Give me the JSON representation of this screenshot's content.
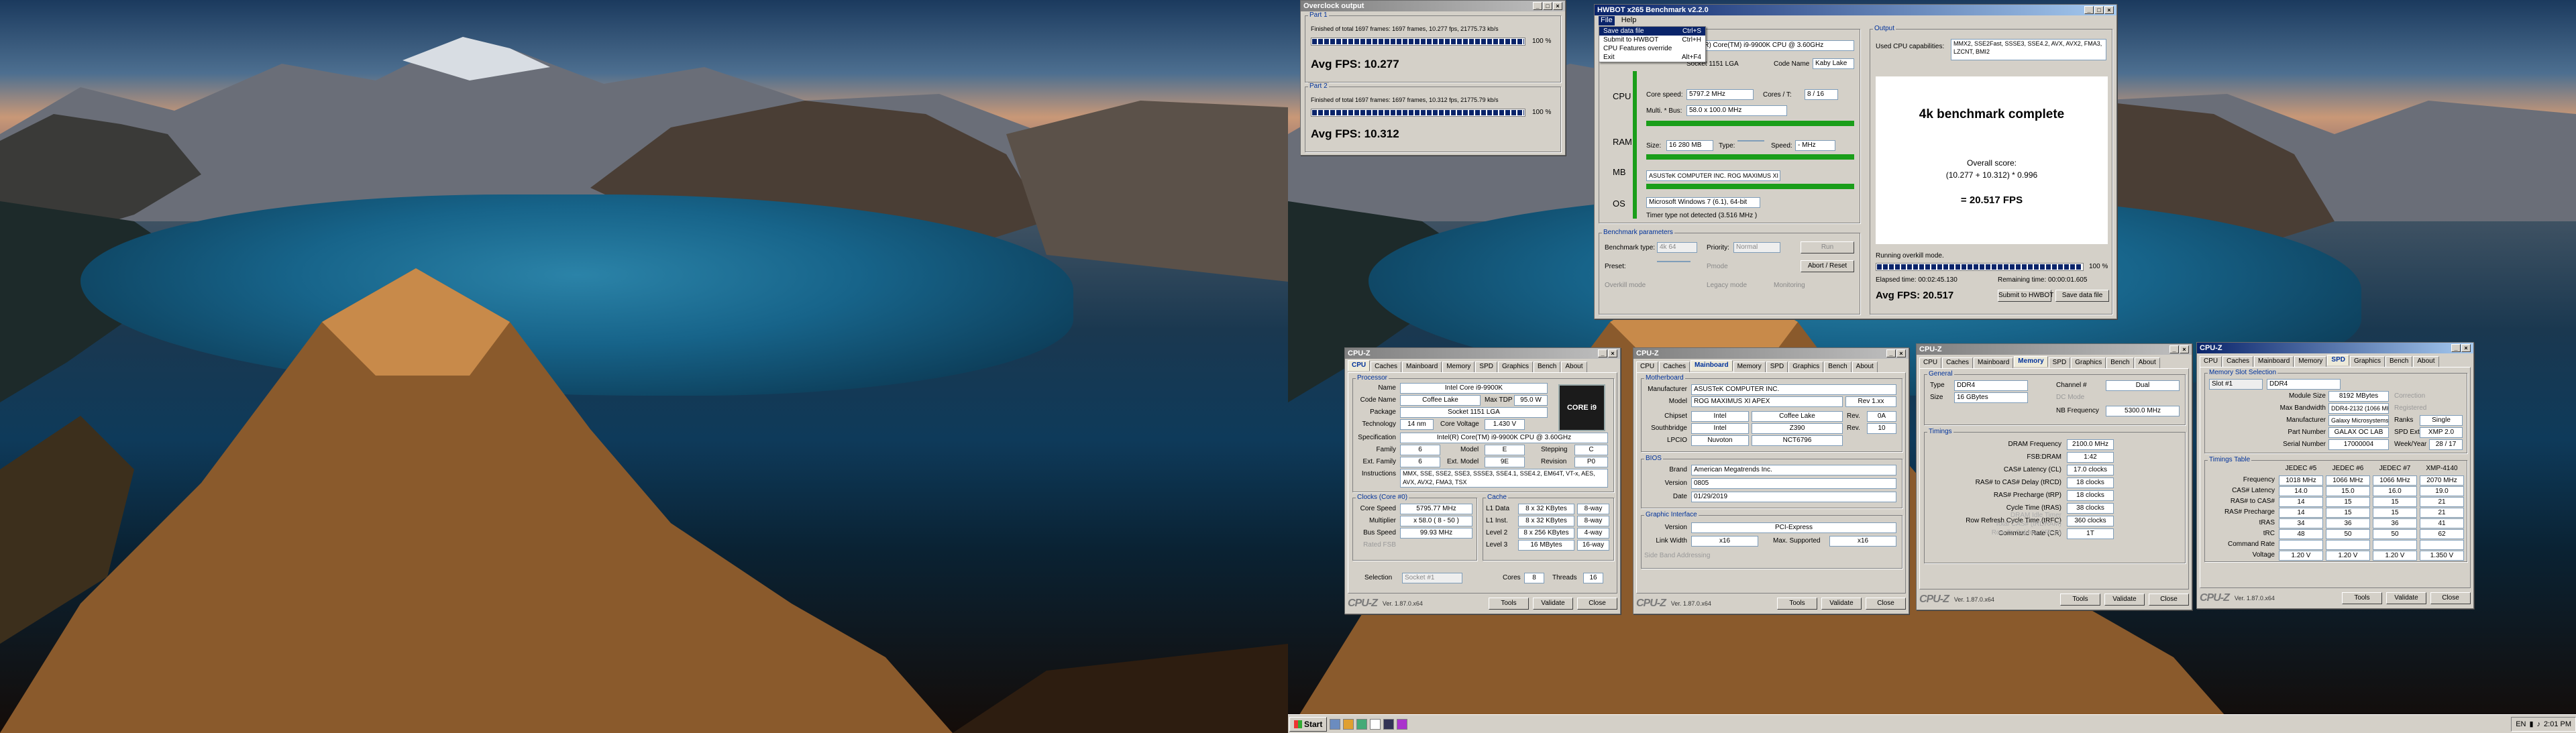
{
  "overclock_output": {
    "title": "Overclock output",
    "part1": {
      "label": "Part 1",
      "status": "Finished of total 1697 frames: 1697 frames, 10.277 fps, 21775.73 kb/s",
      "percent": "100 %",
      "progress": 1.0,
      "avg": "Avg FPS: 10.277"
    },
    "part2": {
      "label": "Part 2",
      "status": "Finished of total 1697 frames: 1697 frames, 10.312 fps, 21775.79 kb/s",
      "percent": "100 %",
      "progress": 1.0,
      "avg": "Avg FPS: 10.312"
    }
  },
  "hwbot": {
    "title": "HWBOT x265 Benchmark v2.2.0",
    "menubar": [
      "File",
      "Help"
    ],
    "file_menu": [
      {
        "label": "Save data file",
        "shortcut": "Ctrl+S"
      },
      {
        "label": "Submit to HWBOT",
        "shortcut": "Ctrl+H"
      },
      {
        "label": "CPU Features override",
        "shortcut": ""
      },
      {
        "label": "Exit",
        "shortcut": "Alt+F4"
      }
    ],
    "processor_field": "Intel(R) Core(TM) i9-9900K CPU @ 3.60GHz",
    "socket_text": "Socket 1151 LGA",
    "codename_label": "Code Name",
    "codename": "Kaby Lake",
    "side_labels": [
      "CPU",
      "RAM",
      "MB",
      "OS"
    ],
    "core_speed_label": "Core speed:",
    "core_speed": "5797.2 MHz",
    "cores_label": "Cores / T:",
    "cores": "8 / 16",
    "multi_label": "Multi. * Bus:",
    "multi": "58.0 x 100.0 MHz",
    "size_label": "Size:",
    "size": "16 280 MB",
    "type_label": "Type:",
    "type": "",
    "speed_label": "Speed:",
    "speed": "- MHz",
    "board": "ASUSTeK COMPUTER INC. ROG MAXIMUS XI APEX",
    "os": "Microsoft Windows 7 (6.1), 64-bit",
    "timer": "Timer type not detected (3.516 MHz )",
    "bench_params": "Benchmark parameters",
    "bench_type_label": "Benchmark type:",
    "bench_type": "4k 64",
    "priority_label": "Priority:",
    "priority": "Normal",
    "run_btn": "Run",
    "preset_label": "Preset:",
    "preset": "",
    "pmode_label": "Pmode",
    "abort_btn": "Abort / Reset",
    "overkill_label": "Overkill mode",
    "legacy_label": "Legacy mode",
    "monitoring_label": "Monitoring",
    "output_label": "Output",
    "used_caps_label": "Used CPU capabilities:",
    "used_caps": "MMX2, SSE2Fast, SSSE3, SSE4.2, AVX, AVX2, FMA3, LZCNT, BMI2",
    "complete": "4k benchmark complete",
    "overall_label": "Overall score:",
    "formula": "(10.277 + 10.312) * 0.996",
    "score": "= 20.517 FPS",
    "running_label": "Running overkill mode.",
    "run_percent": "100 %",
    "run_progress": 1.0,
    "elapsed": "Elapsed time: 00:02:45.130",
    "remaining": "Remaining time: 00:00:01.605",
    "avg": "Avg FPS: 20.517",
    "submit_btn": "Submit to HWBOT",
    "save_btn": "Save data file"
  },
  "cpuz_tabs": [
    "CPU",
    "Caches",
    "Mainboard",
    "Memory",
    "SPD",
    "Graphics",
    "Bench",
    "About"
  ],
  "cpuz_common": {
    "title": "CPU-Z",
    "logo": "CPU-Z",
    "version": "Ver. 1.87.0.x64",
    "tools_btn": "Tools",
    "validate_btn": "Validate",
    "close_btn": "Close"
  },
  "cpuz1": {
    "processor_group": "Processor",
    "rows": [
      {
        "label": "Name",
        "value": "Intel Core i9-9900K"
      },
      {
        "label": "Code Name",
        "value": "Coffee Lake"
      },
      {
        "label": "Package",
        "value": "Socket 1151 LGA"
      },
      {
        "label": "Technology",
        "value": "14 nm"
      }
    ],
    "maxtdp_label": "Max TDP",
    "maxtdp": "95.0 W",
    "corevolt_label": "Core Voltage",
    "corevolt": "1.430 V",
    "badge": "CORE i9",
    "spec_label": "Specification",
    "spec": "Intel(R) Core(TM) i9-9900K CPU @ 3.60GHz",
    "family_label": "Family",
    "family": "6",
    "model_label": "Model",
    "model": "E",
    "stepping_label": "Stepping",
    "stepping": "C",
    "extfam_label": "Ext. Family",
    "extfam": "6",
    "extmodel_label": "Ext. Model",
    "extmodel": "9E",
    "revision_label": "Revision",
    "revision": "P0",
    "instr_label": "Instructions",
    "instr": "MMX, SSE, SSE2, SSE3, SSSE3, SSE4.1, SSE4.2, EM64T, VT-x, AES, AVX, AVX2, FMA3, TSX",
    "clocks_group": "Clocks (Core #0)",
    "corespeed_label": "Core Speed",
    "corespeed": "5795.77 MHz",
    "multiplier_label": "Multiplier",
    "multiplier": "x 58.0 ( 8 - 50 )",
    "busspeed_label": "Bus Speed",
    "busspeed": "99.93 MHz",
    "ratedfsb_label": "Rated FSB",
    "cache_group": "Cache",
    "cache_rows": [
      {
        "label": "L1 Data",
        "value": "8 x 32 KBytes",
        "way": "8-way"
      },
      {
        "label": "L1 Inst.",
        "value": "8 x 32 KBytes",
        "way": "8-way"
      },
      {
        "label": "Level 2",
        "value": "8 x 256 KBytes",
        "way": "4-way"
      },
      {
        "label": "Level 3",
        "value": "16 MBytes",
        "way": "16-way"
      }
    ],
    "selection_label": "Selection",
    "selection": "Socket #1",
    "cores_label": "Cores",
    "cores": "8",
    "threads_label": "Threads",
    "threads": "16"
  },
  "cpuz2": {
    "mb_group": "Motherboard",
    "manufacturer_label": "Manufacturer",
    "manufacturer": "ASUSTeK COMPUTER INC.",
    "model_label": "Model",
    "model": "ROG MAXIMUS XI APEX",
    "rev": "Rev 1.xx",
    "chipset_label": "Chipset",
    "chipset_a": "Intel",
    "chipset_b": "Coffee Lake",
    "chipset_rev_label": "Rev.",
    "chipset_rev": "0A",
    "south_label": "Southbridge",
    "south_a": "Intel",
    "south_b": "Z390",
    "south_rev_label": "Rev.",
    "south_rev": "10",
    "lpcio_label": "LPCIO",
    "lpcio_a": "Nuvoton",
    "lpcio_b": "NCT6796",
    "bios_group": "BIOS",
    "brand_label": "Brand",
    "brand": "American Megatrends Inc.",
    "version_label": "Version",
    "version": "0805",
    "date_label": "Date",
    "date": "01/29/2019",
    "gfx_group": "Graphic Interface",
    "gversion_label": "Version",
    "gversion": "PCI-Express",
    "linkwidth_label": "Link Width",
    "linkwidth": "x16",
    "maxsup_label": "Max. Supported",
    "maxsup": "x16",
    "sideband_label": "Side Band Addressing"
  },
  "cpuz3": {
    "general_group": "General",
    "type_label": "Type",
    "type": "DDR4",
    "channel_label": "Channel #",
    "channel": "Dual",
    "size_label": "Size",
    "size": "16 GBytes",
    "dcmode_label": "DC Mode",
    "nb_label": "NB Frequency",
    "nb": "5300.0 MHz",
    "timings_group": "Timings",
    "rows": [
      {
        "label": "DRAM Frequency",
        "value": "2100.0 MHz"
      },
      {
        "label": "FSB:DRAM",
        "value": "1:42"
      },
      {
        "label": "CAS# Latency (CL)",
        "value": "17.0 clocks"
      },
      {
        "label": "RAS# to CAS# Delay (tRCD)",
        "value": "18 clocks"
      },
      {
        "label": "RAS# Precharge (tRP)",
        "value": "18 clocks"
      },
      {
        "label": "Cycle Time (tRAS)",
        "value": "38 clocks"
      },
      {
        "label": "Row Refresh Cycle Time (tRFC)",
        "value": "360 clocks"
      },
      {
        "label": "Command Rate (CR)",
        "value": "1T"
      }
    ],
    "dim_rows": [
      "DRAM Idle Timer",
      "Total CAS# (tRDRAM)",
      "Row To Column (tRCD)"
    ]
  },
  "cpuz4": {
    "slot_group": "Memory Slot Selection",
    "slot": "Slot #1",
    "slot_type": "DDR4",
    "module_size_label": "Module Size",
    "module_size": "8192 MBytes",
    "correction_label": "Correction",
    "maxbw_label": "Max Bandwidth",
    "maxbw": "DDR4-2132 (1066 MHz)",
    "registered_label": "Registered",
    "manu_label": "Manufacturer",
    "manu": "Galaxy Microsystems Ltd.",
    "ranks_label": "Ranks",
    "ranks": "Single",
    "part_label": "Part Number",
    "part": "GALAX OC LAB",
    "spdext_label": "SPD Ext.",
    "spdext": "XMP 2.0",
    "serial_label": "Serial Number",
    "serial": "17000004",
    "week_label": "Week/Year",
    "week": "28 / 17",
    "timings_group": "Timings Table",
    "cols": [
      "JEDEC #5",
      "JEDEC #6",
      "JEDEC #7",
      "XMP-4140"
    ],
    "rows": [
      {
        "label": "Frequency",
        "values": [
          "1018 MHz",
          "1066 MHz",
          "1066 MHz",
          "2070 MHz"
        ]
      },
      {
        "label": "CAS# Latency",
        "values": [
          "14.0",
          "15.0",
          "16.0",
          "19.0"
        ]
      },
      {
        "label": "RAS# to CAS#",
        "values": [
          "14",
          "15",
          "15",
          "21"
        ]
      },
      {
        "label": "RAS# Precharge",
        "values": [
          "14",
          "15",
          "15",
          "21"
        ]
      },
      {
        "label": "tRAS",
        "values": [
          "34",
          "36",
          "36",
          "41"
        ]
      },
      {
        "label": "tRC",
        "values": [
          "48",
          "50",
          "50",
          "62"
        ]
      },
      {
        "label": "Command Rate",
        "values": [
          "",
          "",
          "",
          ""
        ]
      },
      {
        "label": "Voltage",
        "values": [
          "1.20 V",
          "1.20 V",
          "1.20 V",
          "1.350 V"
        ]
      }
    ]
  },
  "taskbar": {
    "start": "Start",
    "lang": "EN",
    "clock": "2:01 PM"
  }
}
